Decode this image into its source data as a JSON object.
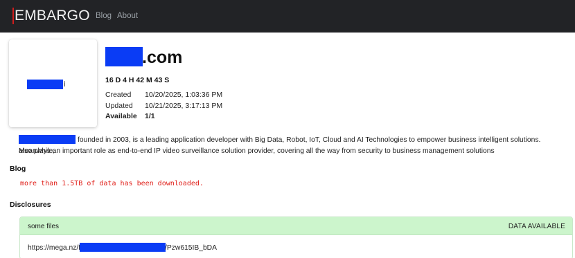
{
  "navbar": {
    "brand": "EMBARGO",
    "links": [
      "Blog",
      "About"
    ]
  },
  "logo": {
    "tail": "i"
  },
  "title": {
    "suffix": ".com"
  },
  "countdown": "16 D 4 H 42 M 43 S",
  "meta": {
    "created_label": "Created",
    "created_value": "10/20/2025, 1:03:36 PM",
    "updated_label": "Updated",
    "updated_value": "10/21/2025, 3:17:13 PM",
    "available_label": "Available",
    "available_value": "1/1"
  },
  "description": {
    "line1": "founded in 2003, is a leading application developer with Big Data, Robot, IoT, Cloud and AI Technologies to empower business intelligent solutions. Meanwhile,",
    "line2": "also plays an important role as end-to-end IP video surveillance solution provider, covering all the way from security to business management solutions"
  },
  "blog": {
    "heading": "Blog",
    "text": "more than 1.5TB of data has been downloaded."
  },
  "disclosures": {
    "heading": "Disclosures",
    "item_name": "some files",
    "item_status": "DATA AVAILABLE",
    "link_prefix": "https://mega.nz/f",
    "link_suffix": "/Pzw615IB_bDA"
  },
  "colors": {
    "navbar_bg": "#222326",
    "brand_accent": "#d01d1d",
    "redaction": "#0a3cf5",
    "blog_text": "#e0201a",
    "disclosure_header": "#ccf5cc"
  }
}
